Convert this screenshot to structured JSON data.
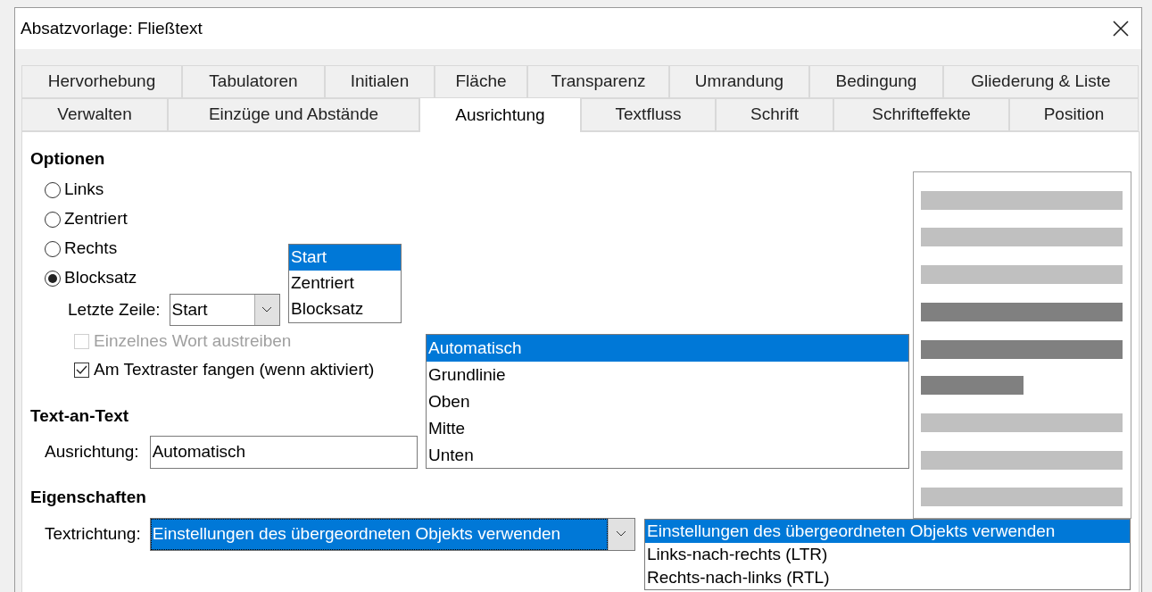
{
  "window": {
    "title": "Absatzvorlage: Fließtext"
  },
  "tab_rows": [
    [
      {
        "label": "Hervorhebung",
        "selected": false
      },
      {
        "label": "Tabulatoren",
        "selected": false
      },
      {
        "label": "Initialen",
        "selected": false
      },
      {
        "label": "Fläche",
        "selected": false
      },
      {
        "label": "Transparenz",
        "selected": false
      },
      {
        "label": "Umrandung",
        "selected": false
      },
      {
        "label": "Bedingung",
        "selected": false
      },
      {
        "label": "Gliederung & Liste",
        "selected": false
      }
    ],
    [
      {
        "label": "Verwalten",
        "selected": false
      },
      {
        "label": "Einzüge und Abstände",
        "selected": false
      },
      {
        "label": "Ausrichtung",
        "selected": true
      },
      {
        "label": "Textfluss",
        "selected": false
      },
      {
        "label": "Schrift",
        "selected": false
      },
      {
        "label": "Schrifteffekte",
        "selected": false
      },
      {
        "label": "Position",
        "selected": false
      }
    ]
  ],
  "options": {
    "heading": "Optionen",
    "radios": [
      {
        "label": "Links",
        "selected": false
      },
      {
        "label": "Zentriert",
        "selected": false
      },
      {
        "label": "Rechts",
        "selected": false
      },
      {
        "label": "Blocksatz",
        "selected": true
      }
    ],
    "last_line": {
      "label": "Letzte Zeile:",
      "value": "Start",
      "options": [
        {
          "label": "Start",
          "selected": true
        },
        {
          "label": "Zentriert",
          "selected": false
        },
        {
          "label": "Blocksatz",
          "selected": false
        }
      ]
    },
    "checkboxes": [
      {
        "label": "Einzelnes Wort austreiben",
        "checked": false,
        "disabled": true
      },
      {
        "label": "Am Textraster fangen (wenn aktiviert)",
        "checked": true,
        "disabled": false
      }
    ]
  },
  "text_to_text": {
    "heading": "Text-an-Text",
    "alignment": {
      "label": "Ausrichtung:",
      "value": "Automatisch",
      "options": [
        {
          "label": "Automatisch",
          "selected": true
        },
        {
          "label": "Grundlinie",
          "selected": false
        },
        {
          "label": "Oben",
          "selected": false
        },
        {
          "label": "Mitte",
          "selected": false
        },
        {
          "label": "Unten",
          "selected": false
        }
      ]
    }
  },
  "properties": {
    "heading": "Eigenschaften",
    "text_direction": {
      "label": "Textrichtung:",
      "value": "Einstellungen des übergeordneten Objekts verwenden",
      "options": [
        {
          "label": "Einstellungen des übergeordneten Objekts verwenden",
          "selected": true
        },
        {
          "label": "Links-nach-rechts (LTR)",
          "selected": false
        },
        {
          "label": "Rechts-nach-links (RTL)",
          "selected": false
        }
      ]
    }
  }
}
